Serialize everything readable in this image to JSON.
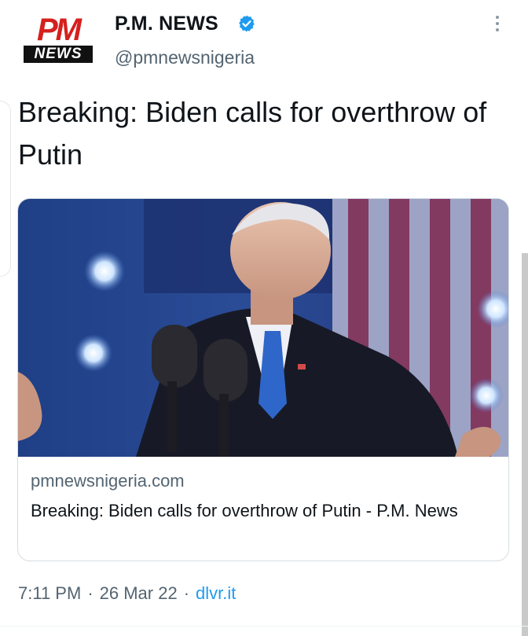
{
  "author": {
    "logo_top": "PM",
    "logo_bottom": "NEWS",
    "name": "P.M. NEWS",
    "handle": "@pmnewsnigeria",
    "verified": true
  },
  "tweet": {
    "text": "Breaking: Biden calls for overthrow of Putin"
  },
  "link_card": {
    "domain": "pmnewsnigeria.com",
    "title": "Breaking: Biden calls for overthrow of Putin - P.M. News",
    "image": "photo-speaker-at-podium-icon"
  },
  "meta": {
    "time": "7:11 PM",
    "separator": "·",
    "date": "26 Mar 22",
    "source": "dlvr.it"
  },
  "colors": {
    "logo_red": "#d5201d",
    "verified_blue": "#1d9bf0",
    "secondary_text": "#536471",
    "link_blue": "#1d9bf0"
  },
  "icons": [
    "verified-badge-icon",
    "more-options-icon"
  ]
}
